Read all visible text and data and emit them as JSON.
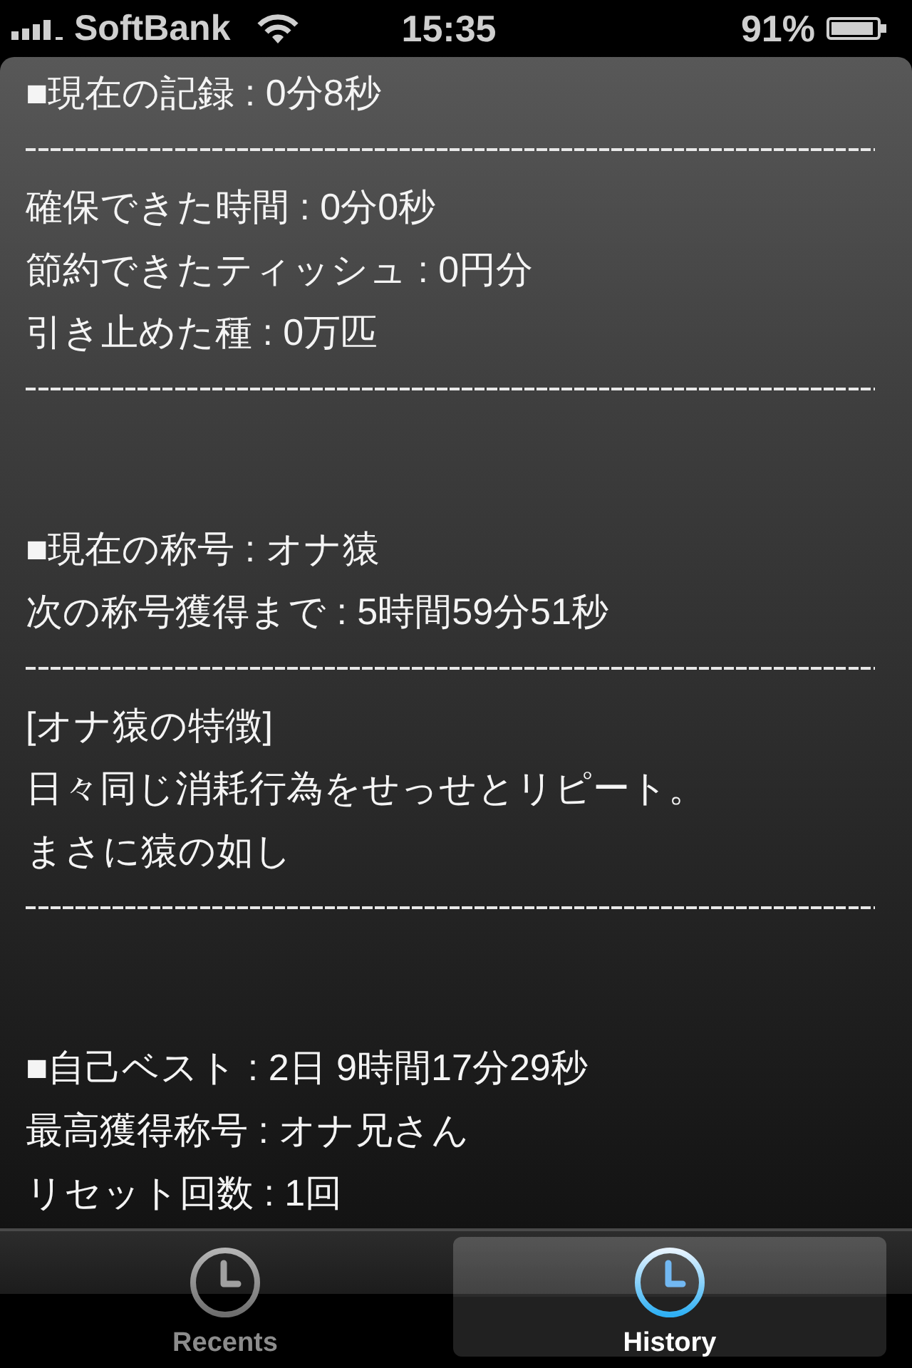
{
  "status_bar": {
    "carrier": "SoftBank",
    "time": "15:35",
    "battery": "91%"
  },
  "sections": [
    {
      "lines": [
        {
          "kind": "text",
          "text": "■現在の記録 : 0分8秒"
        },
        {
          "kind": "divider"
        },
        {
          "kind": "text",
          "text": "確保できた時間 : 0分0秒"
        },
        {
          "kind": "text",
          "text": "節約できたティッシュ : 0円分"
        },
        {
          "kind": "text",
          "text": "引き止めた種 : 0万匹"
        },
        {
          "kind": "divider"
        }
      ]
    },
    {
      "lines": [
        {
          "kind": "text",
          "text": "■現在の称号 : オナ猿"
        },
        {
          "kind": "text",
          "text": "次の称号獲得まで : 5時間59分51秒"
        },
        {
          "kind": "divider"
        },
        {
          "kind": "text",
          "text": "[オナ猿の特徴]"
        },
        {
          "kind": "text",
          "text": "日々同じ消耗行為をせっせとリピート。"
        },
        {
          "kind": "text",
          "text": "まさに猿の如し"
        },
        {
          "kind": "divider"
        }
      ]
    },
    {
      "lines": [
        {
          "kind": "text",
          "text": "■自己ベスト : 2日 9時間17分29秒"
        },
        {
          "kind": "text",
          "text": "最高獲得称号 : オナ兄さん"
        },
        {
          "kind": "text",
          "text": "リセット回数 : 1回"
        }
      ]
    }
  ],
  "tab_bar": {
    "tabs": [
      {
        "label": "Recents",
        "selected": false
      },
      {
        "label": "History",
        "selected": true
      }
    ]
  }
}
